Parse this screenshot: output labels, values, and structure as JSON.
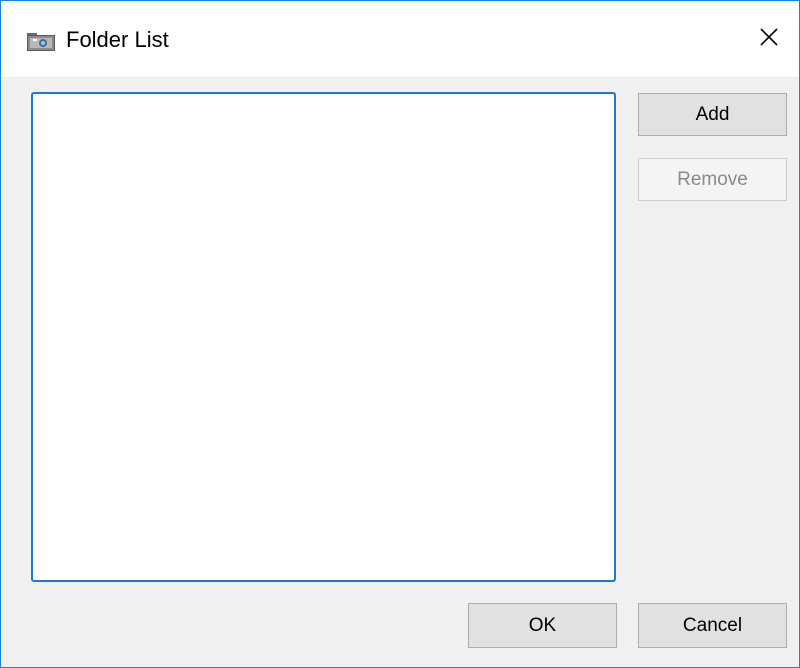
{
  "window": {
    "title": "Folder List",
    "icon": "folder-camera-icon",
    "close_icon": "close-icon"
  },
  "folder_list": {
    "items": []
  },
  "buttons": {
    "add_label": "Add",
    "remove_label": "Remove",
    "remove_enabled": false,
    "ok_label": "OK",
    "cancel_label": "Cancel"
  },
  "colors": {
    "accent": "#1c7ad7",
    "button_bg": "#e1e1e1",
    "disabled_text": "#8a8a8a"
  }
}
